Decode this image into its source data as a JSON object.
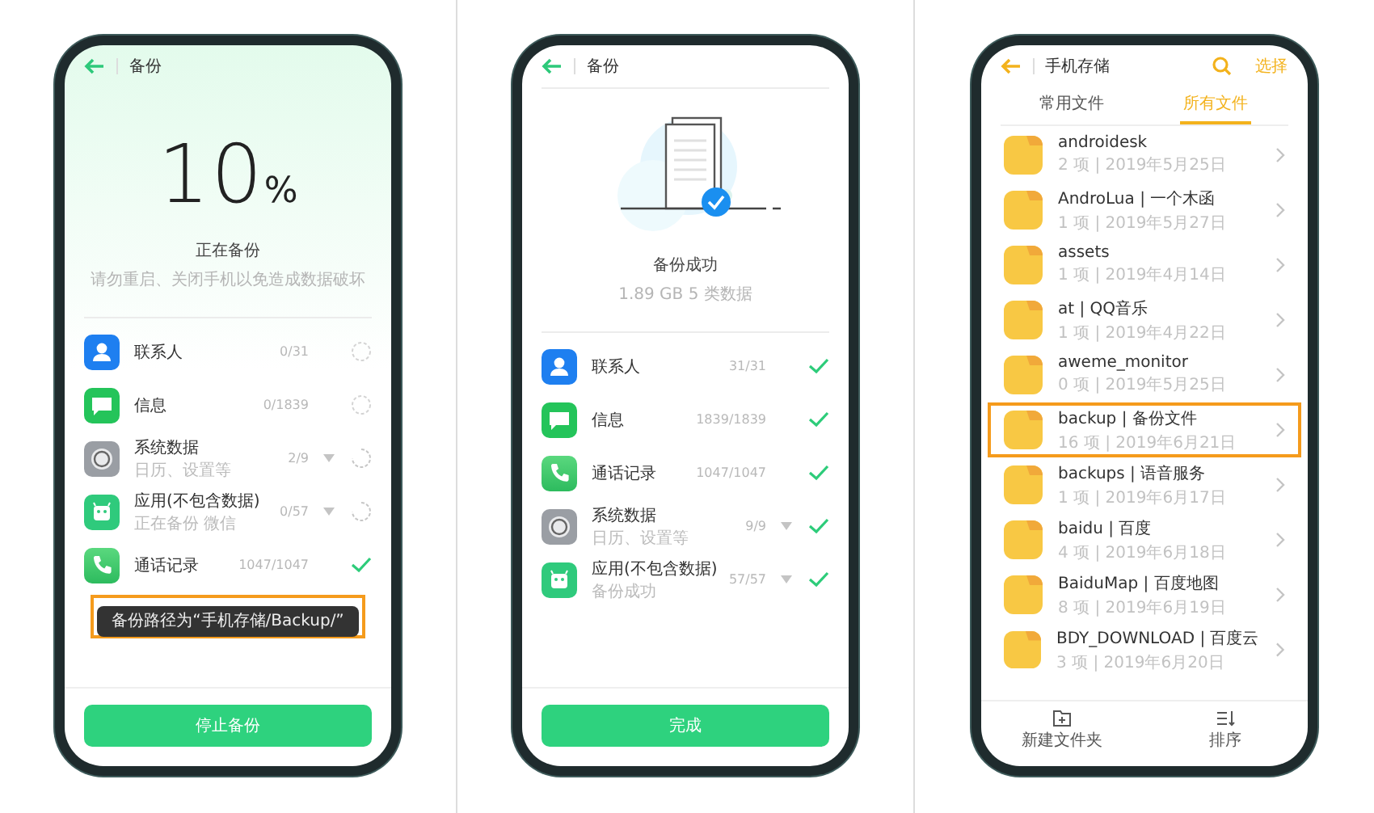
{
  "screens": [
    {
      "kind": "backup_progress",
      "header": {
        "title": "备份"
      },
      "percent_value": "10",
      "percent_unit": "%",
      "status": "正在备份",
      "hint": "请勿重启、关闭手机以免造成数据破坏",
      "items": [
        {
          "kind": "contacts",
          "name": "联系人",
          "count": "0/31",
          "done": false,
          "in_progress": false,
          "expandable": false
        },
        {
          "kind": "messages",
          "name": "信息",
          "count": "0/1839",
          "done": false,
          "in_progress": false,
          "expandable": false
        },
        {
          "kind": "system",
          "name": "系统数据",
          "detail": "日历、设置等",
          "count": "2/9",
          "done": false,
          "in_progress": true,
          "expandable": true
        },
        {
          "kind": "apps",
          "name": "应用(不包含数据)",
          "detail": "正在备份 微信",
          "count": "0/57",
          "done": false,
          "in_progress": true,
          "expandable": true
        },
        {
          "kind": "calls",
          "name": "通话记录",
          "count": "1047/1047",
          "done": true,
          "expandable": false
        }
      ],
      "toast": {
        "text": "备份路径为“手机存储/Backup/”",
        "highlighted": true
      },
      "button": "停止备份"
    },
    {
      "kind": "backup_done",
      "header": {
        "title": "备份"
      },
      "status": "备份成功",
      "summary": "1.89 GB  5 类数据",
      "items": [
        {
          "kind": "contacts",
          "name": "联系人",
          "count": "31/31",
          "done": true,
          "expandable": false
        },
        {
          "kind": "messages",
          "name": "信息",
          "count": "1839/1839",
          "done": true,
          "expandable": false
        },
        {
          "kind": "calls",
          "name": "通话记录",
          "count": "1047/1047",
          "done": true,
          "expandable": false
        },
        {
          "kind": "system",
          "name": "系统数据",
          "detail": "日历、设置等",
          "count": "9/9",
          "done": true,
          "expandable": true
        },
        {
          "kind": "apps",
          "name": "应用(不包含数据)",
          "detail": "备份成功",
          "count": "57/57",
          "done": true,
          "expandable": true
        }
      ],
      "button": "完成"
    },
    {
      "kind": "file_list",
      "header": {
        "title": "手机存储",
        "action": "选择"
      },
      "tabs": [
        {
          "label": "常用文件",
          "selected": false
        },
        {
          "label": "所有文件",
          "selected": true
        }
      ],
      "folders": [
        {
          "name": "androidesk",
          "meta": "2 项 | 2019年5月25日",
          "highlighted": false
        },
        {
          "name": "AndroLua | 一个木函",
          "meta": "1 项 | 2019年5月27日",
          "highlighted": false
        },
        {
          "name": "assets",
          "meta": "1 项 | 2019年4月14日",
          "highlighted": false
        },
        {
          "name": "at | QQ音乐",
          "meta": "1 项 | 2019年4月22日",
          "highlighted": false
        },
        {
          "name": "aweme_monitor",
          "meta": "0 项 | 2019年5月25日",
          "highlighted": false
        },
        {
          "name": "backup | 备份文件",
          "meta": "16 项 | 2019年6月21日",
          "highlighted": true
        },
        {
          "name": "backups | 语音服务",
          "meta": "1 项 | 2019年6月17日",
          "highlighted": false
        },
        {
          "name": "baidu | 百度",
          "meta": "4 项 | 2019年6月18日",
          "highlighted": false
        },
        {
          "name": "BaiduMap | 百度地图",
          "meta": "8 项 | 2019年6月19日",
          "highlighted": false
        },
        {
          "name": "BDY_DOWNLOAD | 百度云",
          "meta": "3 项 | 2019年6月20日",
          "highlighted": false
        }
      ],
      "bottom_bar": [
        {
          "kind": "new_folder",
          "label": "新建文件夹"
        },
        {
          "kind": "sort",
          "label": "排序"
        }
      ]
    }
  ]
}
